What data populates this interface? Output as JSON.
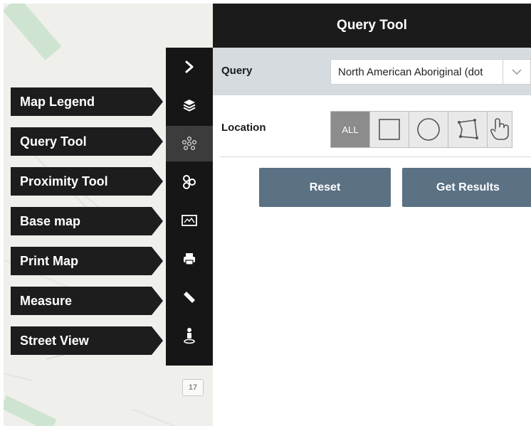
{
  "panel": {
    "title": "Query Tool",
    "query": {
      "label": "Query",
      "value": "North American Aboriginal (dot",
      "caret_icon": "chevron-down-icon"
    },
    "location": {
      "label": "Location",
      "all_label": "ALL",
      "shapes": [
        "rectangle-icon",
        "circle-icon",
        "polygon-icon",
        "hand-pointer-icon"
      ]
    },
    "buttons": {
      "reset": "Reset",
      "get_results": "Get Results"
    }
  },
  "tools": [
    {
      "label": "Map Legend",
      "icon": "layers-icon"
    },
    {
      "label": "Query Tool",
      "icon": "query-nodes-icon"
    },
    {
      "label": "Proximity Tool",
      "icon": "proximity-icon"
    },
    {
      "label": "Base map",
      "icon": "basemap-icon"
    },
    {
      "label": "Print Map",
      "icon": "printer-icon"
    },
    {
      "label": "Measure",
      "icon": "ruler-icon"
    },
    {
      "label": "Street View",
      "icon": "pegman-icon"
    }
  ],
  "strip": {
    "collapse_icon": "chevron-right-icon",
    "active_tool": "Query Tool"
  },
  "map": {
    "zoom_badge": "17"
  },
  "colors": {
    "header": "#1b1b1b",
    "query_row": "#d6dbe0",
    "action_button": "#5b7184",
    "tool_label": "#1d1d1d"
  }
}
